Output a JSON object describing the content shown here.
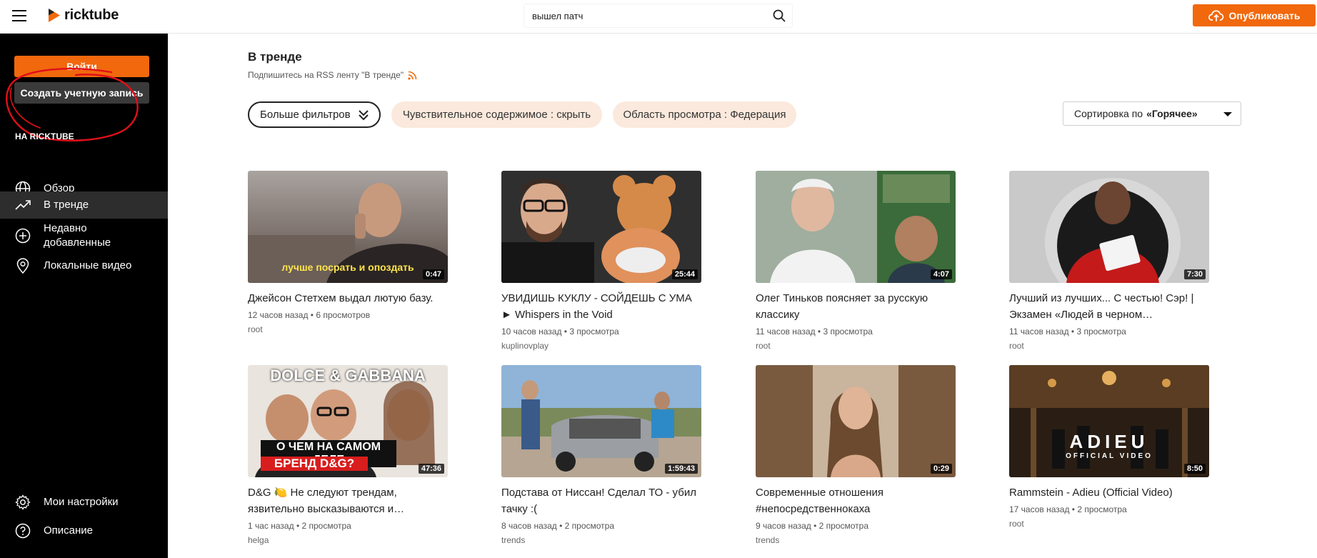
{
  "header": {
    "logo_text": "ricktube",
    "search_value": "вышел патч",
    "publish_label": "Опубликовать"
  },
  "sidebar": {
    "login_label": "Войти",
    "create_account_label": "Создать учетную запись",
    "section_title": "НА RICKTUBE",
    "nav": [
      {
        "label": "Обзор",
        "icon": "globe-icon"
      },
      {
        "label": "В тренде",
        "icon": "trending-icon",
        "active": true
      },
      {
        "label": "Недавно добавленные",
        "icon": "plus-circle-icon"
      },
      {
        "label": "Локальные видео",
        "icon": "location-icon"
      }
    ],
    "bottom": [
      {
        "label": "Мои настройки",
        "icon": "gear-icon"
      },
      {
        "label": "Описание",
        "icon": "help-icon"
      }
    ]
  },
  "main": {
    "title": "В тренде",
    "rss_text": "Подпишитесь на RSS ленту \"В тренде\"",
    "filters": {
      "more_label": "Больше фильтров",
      "sensitive_label": "Чувствительное содержимое : скрыть",
      "scope_label": "Область просмотра : Федерация"
    },
    "sort": {
      "prefix": "Сортировка по",
      "value": "«Горячее»"
    }
  },
  "videos": [
    {
      "title": "Джейсон Стетхем выдал лютую базу.",
      "time_ago": "12 часов назад",
      "views": "6 просмотров",
      "channel": "root",
      "duration": "0:47",
      "caption": "лучше посрать и опоздать"
    },
    {
      "title": "УВИДИШЬ КУКЛУ - СОЙДЕШЬ С УМА ► Whispers in the Void",
      "time_ago": "10 часов назад",
      "views": "3 просмотра",
      "channel": "kuplinovplay",
      "duration": "25:44"
    },
    {
      "title": "Олег Тиньков поясняет за русскую классику",
      "time_ago": "11 часов назад",
      "views": "3 просмотра",
      "channel": "root",
      "duration": "4:07"
    },
    {
      "title": "Лучший из лучших... С честью! Сэр! | Экзамен «Людей в черном…",
      "time_ago": "11 часов назад",
      "views": "3 просмотра",
      "channel": "root",
      "duration": "7:30"
    },
    {
      "title": "D&G 🍋 Не следуют трендам, язвительно высказываются и…",
      "time_ago": "1 час назад",
      "views": "2 просмотра",
      "channel": "helga",
      "duration": "47:36",
      "caption_top": "DOLCE & GABBANA",
      "caption": "О ЧЕМ НА САМОМ ДЕЛЕ",
      "caption2": "БРЕНД D&G?"
    },
    {
      "title": "Подстава от Ниссан! Сделал ТО - убил тачку :(",
      "time_ago": "8 часов назад",
      "views": "2 просмотра",
      "channel": "trends",
      "duration": "1:59:43"
    },
    {
      "title": "Современные отношения #непосредственнокаха",
      "time_ago": "9 часов назад",
      "views": "2 просмотра",
      "channel": "trends",
      "duration": "0:29"
    },
    {
      "title": "Rammstein - Adieu (Official Video)",
      "time_ago": "17 часов назад",
      "views": "2 просмотра",
      "channel": "root",
      "duration": "8:50",
      "caption": "ADIEU",
      "caption2": "OFFICIAL VIDEO"
    }
  ],
  "colors": {
    "accent": "#f1680d",
    "sidebar_bg": "#000000",
    "chip_bg": "#fae9dc",
    "annotation_red": "#e0101a"
  }
}
